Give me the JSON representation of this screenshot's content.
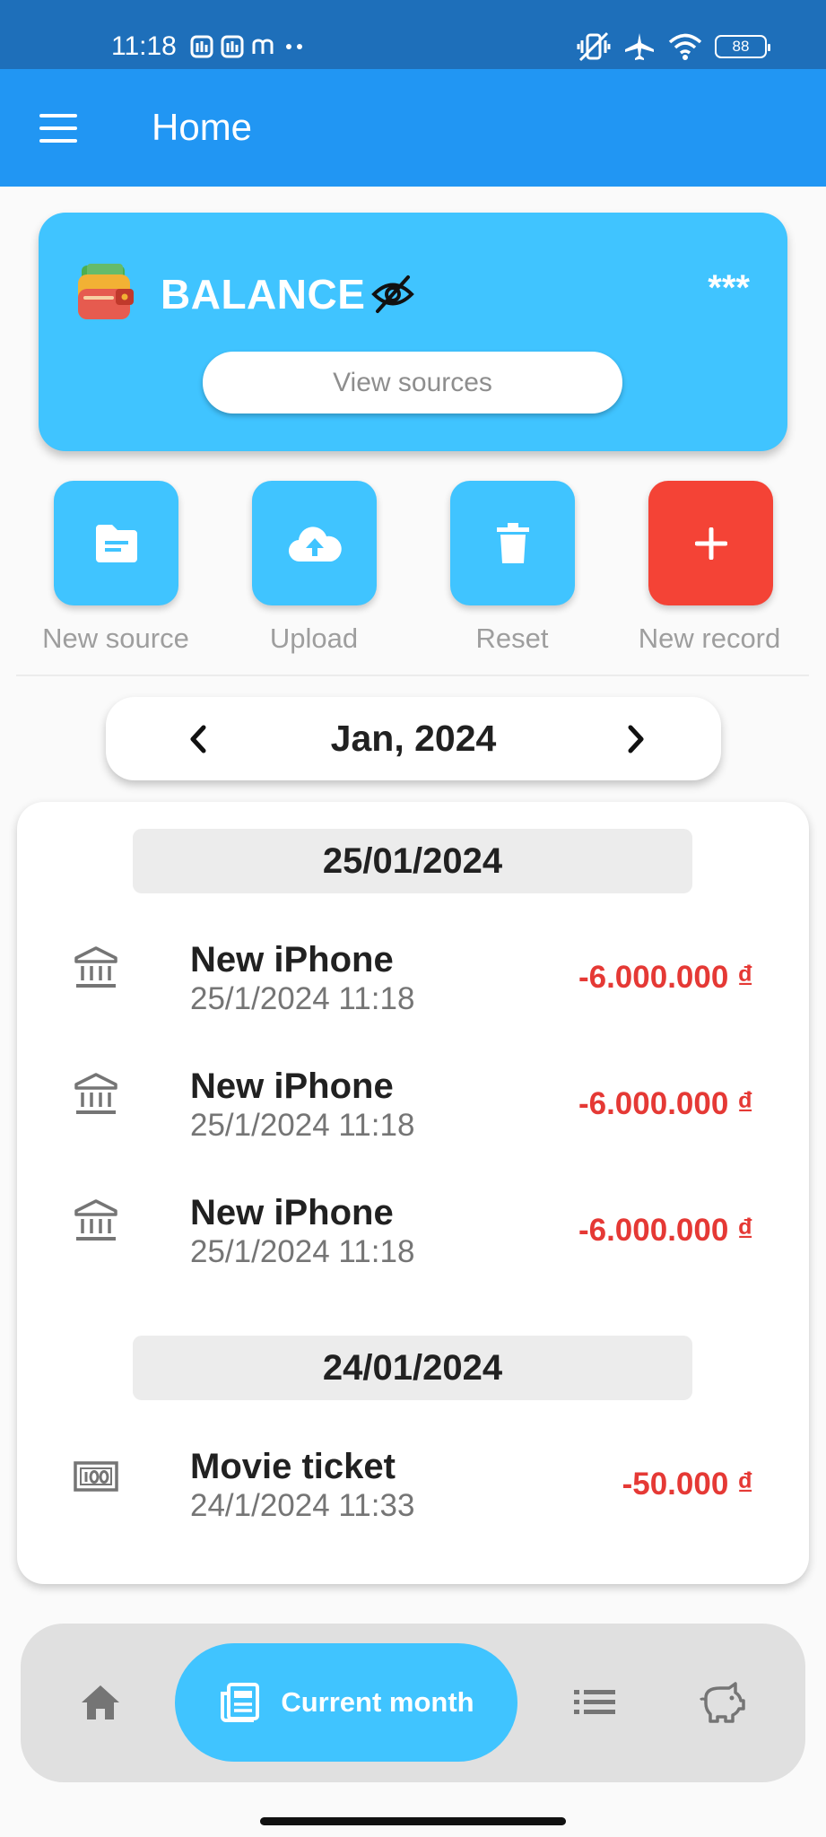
{
  "status_bar": {
    "time": "11:18",
    "left_icons": [
      "notification-app-icon",
      "notification-app-icon",
      "m-icon",
      "more-dots-icon"
    ],
    "right_icons": [
      "vibrate-off-icon",
      "airplane-icon",
      "wifi-icon"
    ],
    "battery": "88"
  },
  "app_bar": {
    "title": "Home",
    "menu_icon": "hamburger-menu-icon"
  },
  "balance": {
    "label": "BALANCE",
    "value": "***",
    "visibility_icon": "eye-off-icon",
    "view_sources_label": "View sources"
  },
  "actions": [
    {
      "label": "New source",
      "icon": "folder-icon",
      "color": "#40c4ff"
    },
    {
      "label": "Upload",
      "icon": "cloud-upload-icon",
      "color": "#40c4ff"
    },
    {
      "label": "Reset",
      "icon": "trash-icon",
      "color": "#40c4ff"
    },
    {
      "label": "New record",
      "icon": "plus-icon",
      "color": "#f44336"
    }
  ],
  "month_picker": {
    "label": "Jan, 2024"
  },
  "records": {
    "groups": [
      {
        "date": "25/01/2024",
        "items": [
          {
            "title": "New iPhone",
            "time": "25/1/2024 11:18",
            "amount": "-6.000.000 ₫",
            "icon": "bank-icon"
          },
          {
            "title": "New iPhone",
            "time": "25/1/2024 11:18",
            "amount": "-6.000.000 ₫",
            "icon": "bank-icon"
          },
          {
            "title": "New iPhone",
            "time": "25/1/2024 11:18",
            "amount": "-6.000.000 ₫",
            "icon": "bank-icon"
          }
        ]
      },
      {
        "date": "24/01/2024",
        "items": [
          {
            "title": "Movie ticket",
            "time": "24/1/2024 11:33",
            "amount": "-50.000 ₫",
            "icon": "cash-icon"
          }
        ]
      }
    ]
  },
  "bottom_nav": {
    "active_label": "Current month",
    "items": [
      "home-icon",
      "newspaper-icon",
      "list-icon",
      "piggy-bank-icon"
    ]
  },
  "colors": {
    "status_bar": "#1e6fba",
    "app_bar": "#2196f3",
    "accent": "#40c4ff",
    "danger": "#f44336",
    "amount": "#e53935"
  }
}
